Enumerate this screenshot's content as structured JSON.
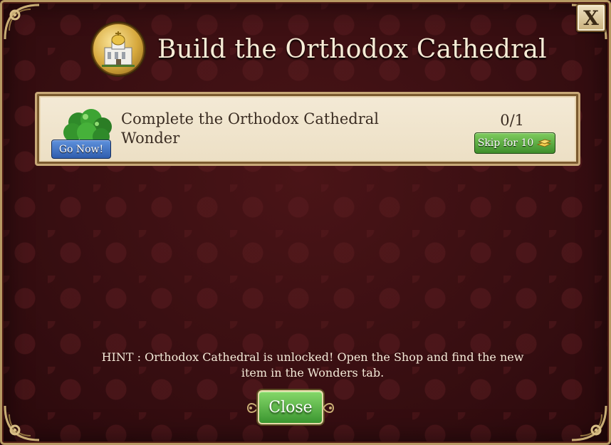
{
  "dialog": {
    "title": "Build the Orthodox Cathedral",
    "title_icon": "cathedral-icon",
    "close_x_label": "X"
  },
  "task": {
    "description": "Complete the Orthodox Cathedral Wonder",
    "progress": "0/1",
    "go_now_label": "Go Now!",
    "skip_label": "Skip for 10",
    "skip_currency_icon": "gold-bars-icon",
    "image_icon": "trees-icon"
  },
  "hint": "HINT : Orthodox Cathedral is unlocked! Open the Shop and find the new item in the Wonders tab.",
  "close_button_label": "Close",
  "colors": {
    "background": "#3a0f12",
    "frame_gold": "#b79a63",
    "card_bg": "#f4ead6",
    "go_button_blue": "#2f5eae",
    "skip_button_green": "#3f8f2c",
    "close_button_green": "#3b9630"
  }
}
